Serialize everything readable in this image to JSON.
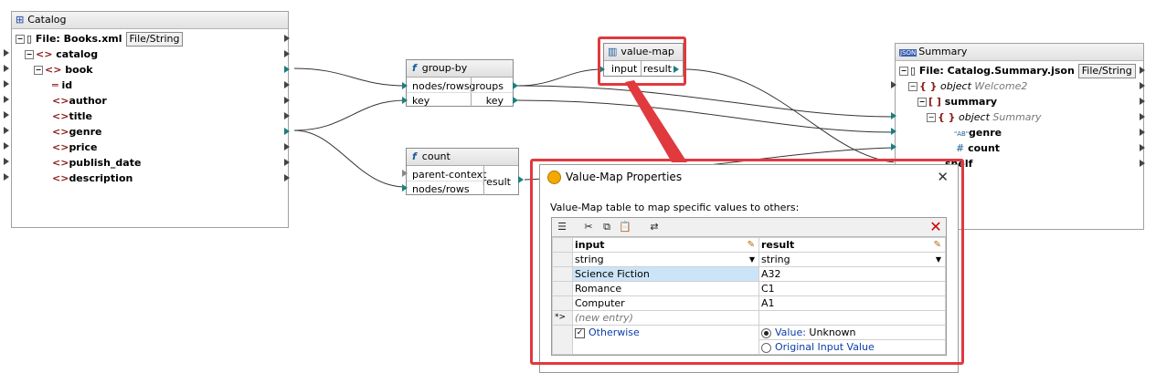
{
  "catalog": {
    "title": "Catalog",
    "file_label": "File: Books.xml",
    "file_button": "File/String",
    "items": [
      {
        "label": "catalog"
      },
      {
        "label": "book"
      },
      {
        "label": "id"
      },
      {
        "label": "author"
      },
      {
        "label": "title"
      },
      {
        "label": "genre"
      },
      {
        "label": "price"
      },
      {
        "label": "publish_date"
      },
      {
        "label": "description"
      }
    ]
  },
  "group_by": {
    "title": "group-by",
    "in1": "nodes/rows",
    "in2": "key",
    "out1": "groups",
    "out2": "key"
  },
  "count": {
    "title": "count",
    "in1": "parent-context",
    "in2": "nodes/rows",
    "out1": "result"
  },
  "value_map": {
    "title": "value-map",
    "in1": "input",
    "out1": "result"
  },
  "summary": {
    "title": "Summary",
    "file_label": "File: Catalog.Summary.json",
    "file_button": "File/String",
    "items": [
      {
        "label": "object",
        "type": "Welcome2"
      },
      {
        "label": "summary"
      },
      {
        "label": "object",
        "type": "Summary"
      },
      {
        "label": "genre"
      },
      {
        "label": "count"
      },
      {
        "label": "shelf"
      }
    ]
  },
  "dialog": {
    "title": "Value-Map Properties",
    "description": "Value-Map table to map specific values to others:",
    "col_input": "input",
    "col_result": "result",
    "type_input": "string",
    "type_result": "string",
    "rows": [
      {
        "input": "Science Fiction",
        "result": "A32"
      },
      {
        "input": "Romance",
        "result": "C1"
      },
      {
        "input": "Computer",
        "result": "A1"
      }
    ],
    "new_marker": "*>",
    "new_entry": "(new entry)",
    "otherwise": "Otherwise",
    "value_option": "Value:",
    "value_text": "Unknown",
    "original_option": "Original Input Value"
  },
  "colors": {
    "callout": "#e0393e",
    "wire_teal": "#1a7f7f",
    "tag": "#8b1a1a",
    "link_blue": "#0a3ea8"
  }
}
